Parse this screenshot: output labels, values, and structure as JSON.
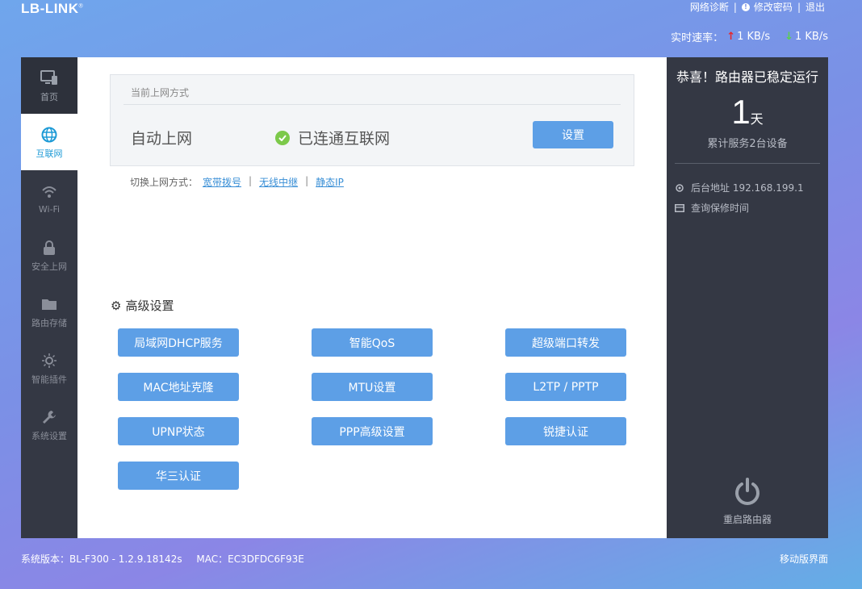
{
  "brand": {
    "logo": "LB-LINK",
    "logo_mark": "®"
  },
  "toplinks": {
    "diagnose": "网络诊断",
    "change_password": "修改密码",
    "logout": "退出",
    "separator": "|"
  },
  "speed": {
    "label": "实时速率：",
    "up": "1 KB/s",
    "down": "1 KB/s",
    "up_color": "#e6282c",
    "down_color": "#5ad04c"
  },
  "nav": [
    {
      "label": "首页",
      "icon": "monitor-icon"
    },
    {
      "label": "互联网",
      "icon": "globe-icon"
    },
    {
      "label": "Wi-Fi",
      "icon": "wifi-icon"
    },
    {
      "label": "安全上网",
      "icon": "lock-icon"
    },
    {
      "label": "路由存储",
      "icon": "folder-icon"
    },
    {
      "label": "智能插件",
      "icon": "bulb-icon"
    },
    {
      "label": "系统设置",
      "icon": "wrench-icon"
    }
  ],
  "connection": {
    "card_title": "当前上网方式",
    "mode": "自动上网",
    "status": "已连通互联网",
    "set_button": "设置",
    "switch_label": "切换上网方式：",
    "options": [
      "宽带拨号",
      "无线中继",
      "静态IP"
    ],
    "separator": "|"
  },
  "advanced": {
    "title": "高级设置",
    "buttons": [
      "局域网DHCP服务",
      "智能QoS",
      "超级端口转发",
      "MAC地址克隆",
      "MTU设置",
      "L2TP / PPTP",
      "UPNP状态",
      "PPP高级设置",
      "锐捷认证",
      "华三认证"
    ]
  },
  "status_panel": {
    "title": "恭喜！路由器已稳定运行",
    "days": "1",
    "days_unit": "天",
    "devices": "累计服务2台设备",
    "admin_address": "后台地址 192.168.199.1",
    "warranty": "查询保修时间",
    "restart": "重启路由器"
  },
  "footer": {
    "version": "系统版本：BL-F300 - 1.2.9.18142s",
    "mac": "MAC：EC3DFDC6F93E",
    "mobile": "移动版界面"
  },
  "colors": {
    "accent": "#5d9fe6",
    "sidebar": "#343844",
    "active": "#1d9ad6",
    "ok": "#7cc94a"
  }
}
